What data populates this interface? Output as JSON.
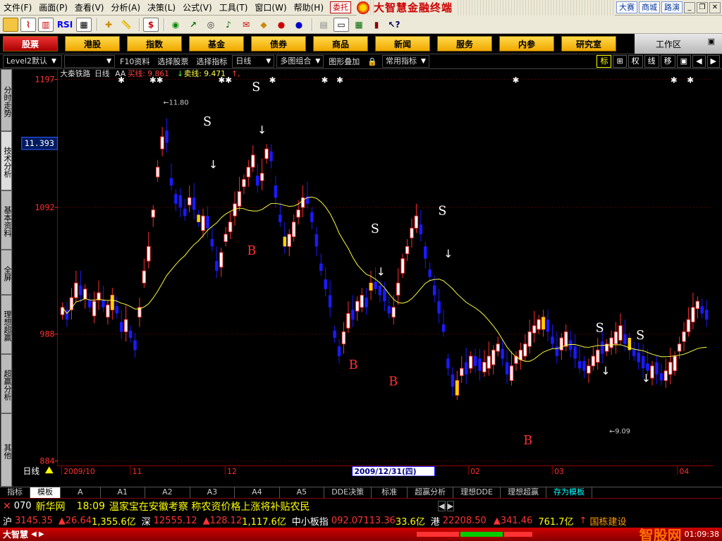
{
  "menubar": {
    "items": [
      "文件(F)",
      "画面(P)",
      "查看(V)",
      "分析(A)",
      "决策(L)",
      "公式(V)",
      "工具(T)",
      "窗口(W)",
      "帮助(H)"
    ],
    "tag": "委托",
    "brand": "大智慧金融终端",
    "right_buttons": [
      "大赛",
      "商城",
      "路演"
    ]
  },
  "nav": {
    "buttons": [
      "股票",
      "港股",
      "指数",
      "基金",
      "债券",
      "商品",
      "新闻",
      "服务",
      "内参",
      "研究室"
    ],
    "workarea": "工作区"
  },
  "funcbar": {
    "level": "Level2默认",
    "items": [
      "F10资料",
      "选择股票",
      "选择指标",
      "日线",
      "多图组合",
      "图形叠加",
      "常用指标"
    ],
    "right_tools": [
      "标",
      "权",
      "线",
      "移"
    ]
  },
  "left_tabs": [
    "分时走势",
    "技术分析",
    "基本资料",
    "全屏",
    "理想超赢",
    "超赢分析",
    "其他"
  ],
  "chart": {
    "stock_name": "大秦铁路",
    "period": "日线",
    "indicator": "AA",
    "buy_label": "买线: 9.861",
    "sell_label": "卖线: 9.471",
    "price_ticks": [
      "1197",
      "1092",
      "988",
      "884"
    ],
    "current_price": "11.393",
    "high_label": "11.80",
    "low_label": "9.09",
    "x_labels": [
      "2009/10",
      "11",
      "12",
      "02",
      "03",
      "04"
    ],
    "cursor_date": "2009/12/31(四)",
    "period_corner": "日线",
    "colors": {
      "up": "#ff3030",
      "down": "#1a1aff",
      "ma": "#ffff40",
      "axis": "#8b0000"
    }
  },
  "bottom_tabs": [
    "指标",
    "模板",
    "A",
    "A1",
    "A2",
    "A3",
    "A4",
    "A5",
    "DDE决策",
    "标准",
    "超赢分析",
    "理想DDE",
    "理想超赢",
    "存为模板"
  ],
  "news": {
    "count": "070",
    "source": "新华网",
    "time": "18:09",
    "headline": "温家宝在安徽考察 称农资价格上涨将补贴农民",
    "tail": "国栋建设"
  },
  "quotes": {
    "sh_label": "沪",
    "sh_index": "3145.35",
    "sh_change": "26.64",
    "sh_amount": "1,355.6亿",
    "sz_label": "深",
    "sz_index": "12555.12",
    "sz_change": "128.12",
    "sz_amount": "1,117.6亿",
    "mid_label": "中小板指",
    "mid_index": "092.07",
    "mid_change": "113.36",
    "mid_amount": "33.6亿",
    "hk_label": "港",
    "hk_index": "22208.50",
    "hk_change": "341.46",
    "hk_amount": "761.7亿"
  },
  "status": {
    "brand": "大智慧",
    "time": "01:09:38",
    "watermark": "智股网"
  }
}
